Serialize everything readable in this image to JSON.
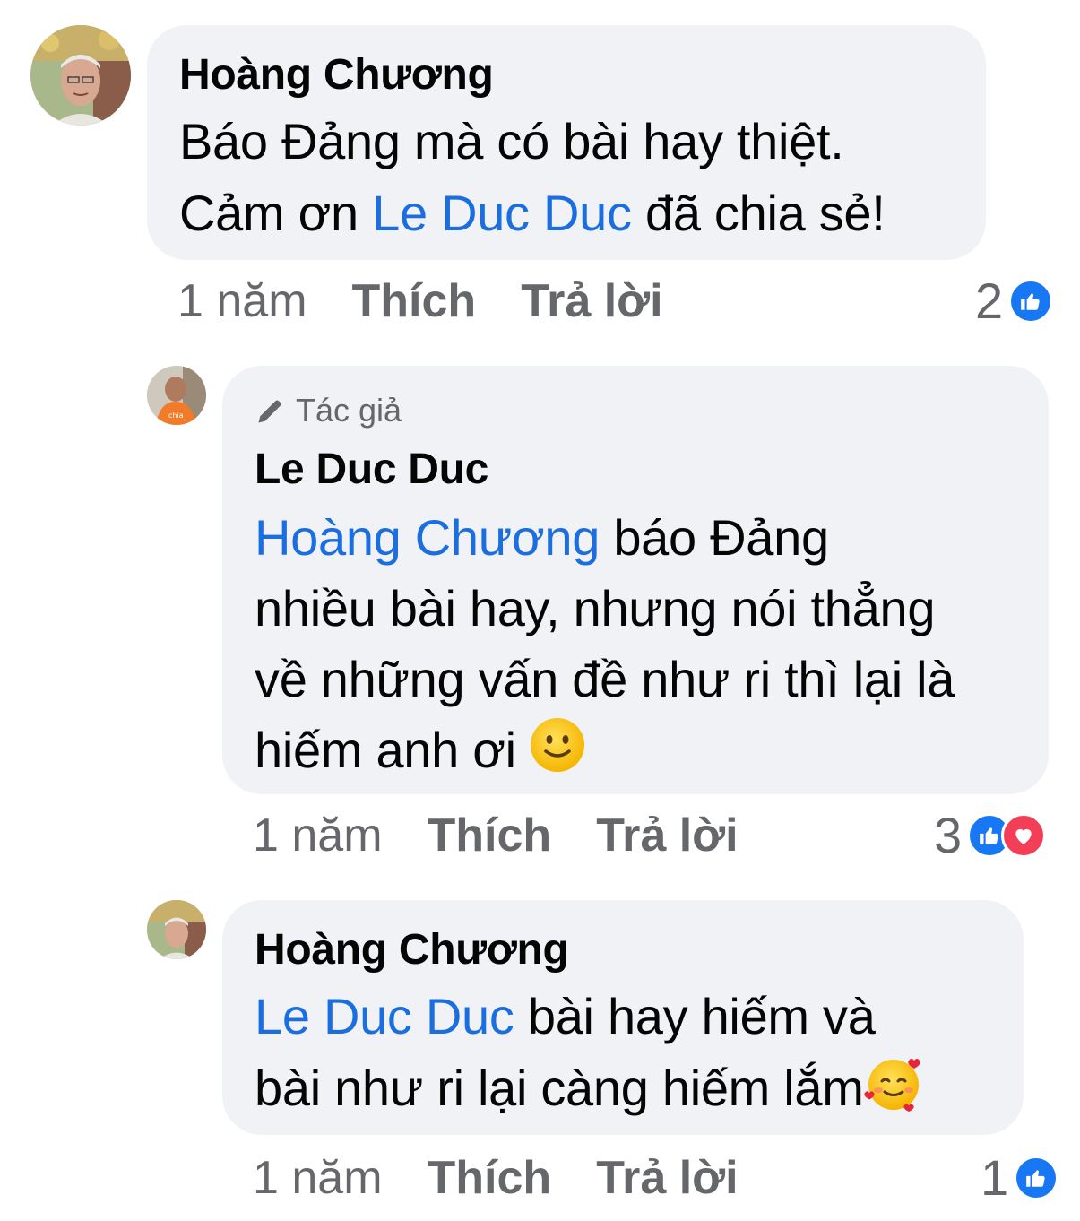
{
  "comments": [
    {
      "author": "Hoàng Chương",
      "text_line1": "Báo Đảng mà có bài hay thiệt.",
      "text_line2_before": "Cảm ơn ",
      "text_line2_mention": "Le Duc Duc",
      "text_line2_after": " đã chia sẻ!",
      "time": "1 năm",
      "like_label": "Thích",
      "reply_label": "Trả lời",
      "reaction_count": "2",
      "reactions": [
        "like-icon"
      ]
    },
    {
      "badge": "Tác giả",
      "author": "Le Duc Duc",
      "mention": "Hoàng Chương",
      "text_line1_after": " báo Đảng",
      "text_line2": "nhiều bài hay, nhưng nói thẳng",
      "text_line3": "về những vấn đề như ri thì lại là",
      "text_line4": "hiếm anh ơi ",
      "emoji": "slightly-smiling-face-emoji",
      "time": "1 năm",
      "like_label": "Thích",
      "reply_label": "Trả lời",
      "reaction_count": "3",
      "reactions": [
        "like-icon",
        "love-icon"
      ]
    },
    {
      "author": "Hoàng Chương",
      "mention": "Le Duc Duc",
      "text_line1_after": " bài hay hiếm và",
      "text_line2": "bài như ri lại càng hiếm lắm",
      "emoji": "smiling-face-with-hearts-emoji",
      "time": "1 năm",
      "like_label": "Thích",
      "reply_label": "Trả lời",
      "reaction_count": "1",
      "reactions": [
        "like-icon"
      ]
    }
  ],
  "colors": {
    "bubble": "#f0f2f5",
    "mention": "#1b6ee0",
    "meta": "#65676b",
    "like": "#1877f2",
    "love": "#f33e58"
  }
}
